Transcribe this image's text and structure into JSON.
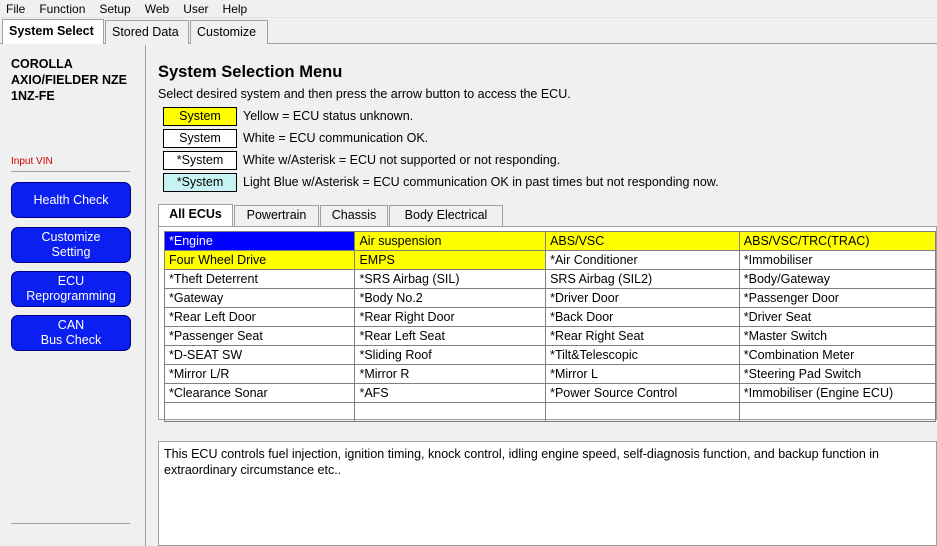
{
  "menu": [
    "File",
    "Function",
    "Setup",
    "Web",
    "User",
    "Help"
  ],
  "top_tabs": [
    "System Select",
    "Stored Data",
    "Customize"
  ],
  "vehicle": {
    "line1": "COROLLA",
    "line2": "AXIO/FIELDER NZE",
    "line3": "1NZ-FE"
  },
  "input_vin": "Input VIN",
  "nav_buttons": [
    [
      "Health Check"
    ],
    [
      "Customize",
      "Setting"
    ],
    [
      "ECU",
      "Reprogramming"
    ],
    [
      "CAN",
      "Bus Check"
    ]
  ],
  "main": {
    "title": "System Selection Menu",
    "instruction": "Select desired system and then press the arrow button to access the ECU."
  },
  "legend": [
    {
      "box": "System",
      "bg": "#ffff00",
      "text": "Yellow = ECU status unknown."
    },
    {
      "box": "System",
      "bg": "#ffffff",
      "text": "White = ECU communication OK."
    },
    {
      "box": "*System",
      "bg": "#ffffff",
      "text": "White w/Asterisk = ECU not supported or not responding."
    },
    {
      "box": "*System",
      "bg": "#c6f4f4",
      "text": "Light Blue w/Asterisk = ECU communication OK in past times but not responding now."
    }
  ],
  "sub_tabs": [
    "All ECUs",
    "Powertrain",
    "Chassis",
    "Body Electrical"
  ],
  "ecu_grid": [
    [
      "*Engine",
      "Air suspension",
      "ABS/VSC",
      "ABS/VSC/TRC(TRAC)"
    ],
    [
      "Four Wheel Drive",
      "EMPS",
      "*Air Conditioner",
      "*Immobiliser"
    ],
    [
      "*Theft Deterrent",
      "*SRS Airbag (SIL)",
      "SRS Airbag (SIL2)",
      "*Body/Gateway"
    ],
    [
      "*Gateway",
      "*Body No.2",
      "*Driver Door",
      "*Passenger Door"
    ],
    [
      "*Rear Left Door",
      "*Rear Right Door",
      "*Back Door",
      "*Driver Seat"
    ],
    [
      "*Passenger Seat",
      "*Rear Left Seat",
      "*Rear Right Seat",
      "*Master Switch"
    ],
    [
      "*D-SEAT SW",
      "*Sliding Roof",
      "*Tilt&Telescopic",
      "*Combination Meter"
    ],
    [
      "*Mirror L/R",
      "*Mirror R",
      "*Mirror L",
      "*Steering Pad Switch"
    ],
    [
      "*Clearance Sonar",
      "*AFS",
      "*Power Source Control",
      "*Immobiliser (Engine ECU)"
    ],
    [
      "",
      "",
      "",
      ""
    ]
  ],
  "cell_status": [
    [
      "selected",
      "yellow",
      "yellow",
      "yellow"
    ],
    [
      "yellow",
      "yellow",
      "",
      ""
    ],
    [
      "",
      "",
      "",
      ""
    ],
    [
      "",
      "",
      "",
      ""
    ],
    [
      "",
      "",
      "",
      ""
    ],
    [
      "",
      "",
      "",
      ""
    ],
    [
      "",
      "",
      "",
      ""
    ],
    [
      "",
      "",
      "",
      ""
    ],
    [
      "",
      "",
      "",
      ""
    ],
    [
      "",
      "",
      "",
      ""
    ]
  ],
  "description": "This ECU controls fuel injection, ignition timing, knock control, idling engine speed, self-diagnosis function, and backup function in extraordinary circumstance etc.."
}
